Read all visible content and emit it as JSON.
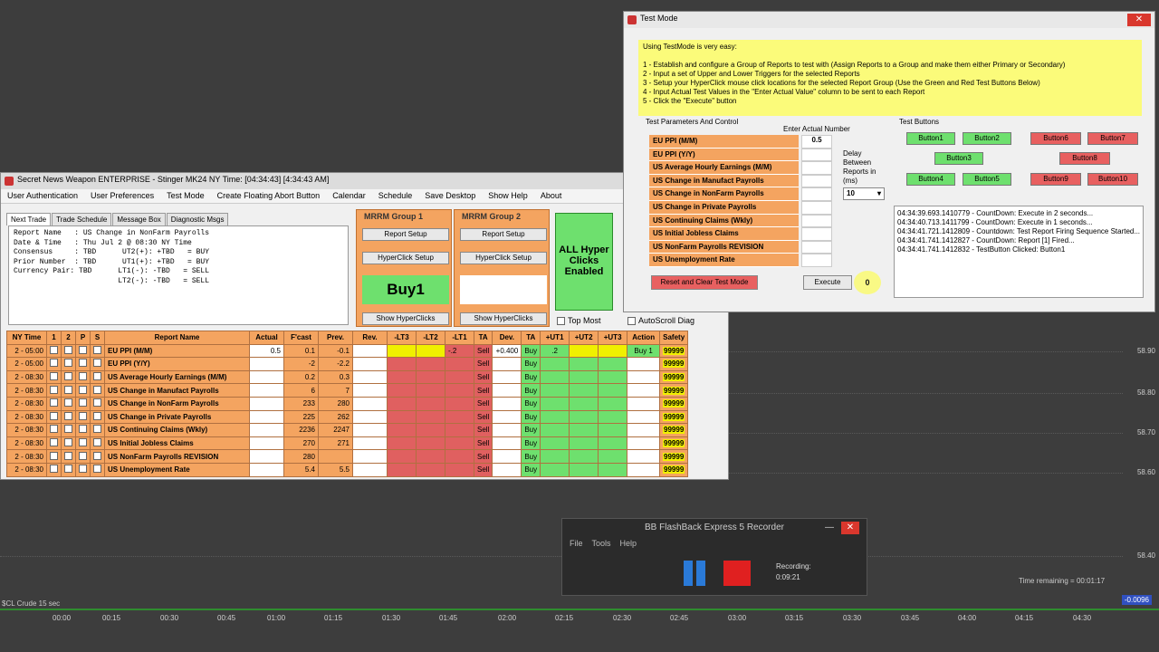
{
  "background_chart": {
    "prices": [
      "58.90",
      "58.80",
      "58.70",
      "58.60",
      "58.40"
    ],
    "times": [
      "00:00",
      "00:15",
      "00:30",
      "00:45",
      "01:00",
      "01:15",
      "01:30",
      "01:45",
      "02:00",
      "02:15",
      "02:30",
      "02:45",
      "03:00",
      "03:15",
      "03:30",
      "03:45",
      "04:00",
      "04:15",
      "04:30"
    ],
    "time_remaining": "Time remaining = 00:01:17",
    "last_badge": "-0.0096",
    "left_label": "$CL Crude  15 sec"
  },
  "main": {
    "title": "Secret News Weapon ENTERPRISE - Stinger MK24     NY Time: [04:34:43]  [4:34:43 AM]",
    "menu": [
      "User Authentication",
      "User Preferences",
      "Test Mode",
      "Create Floating Abort Button",
      "Calendar",
      "Schedule",
      "Save Desktop",
      "Show Help",
      "About"
    ],
    "tabs": [
      "Next Trade",
      "Trade Schedule",
      "Message Box",
      "Diagnostic Msgs"
    ],
    "info": "Report Name   : US Change in NonFarm Payrolls\nDate & Time   : Thu Jul 2 @ 08:30 NY Time\nConsensus     : TBD      UT2(+): +TBD   = BUY\nPrior Number  : TBD      UT1(+): +TBD   = BUY\nCurrency Pair: TBD      LT1(-): -TBD   = SELL\n                        LT2(-): -TBD   = SELL",
    "group1": {
      "title": "MRRM  Group 1",
      "setup": "Report Setup",
      "hyper": "HyperClick Setup",
      "big": "Buy1",
      "show": "Show HyperClicks"
    },
    "group2": {
      "title": "MRRM  Group 2",
      "setup": "Report Setup",
      "hyper": "HyperClick Setup",
      "big": "",
      "show": "Show HyperClicks"
    },
    "all_hyper": "ALL Hyper Clicks Enabled",
    "top_most": "Top Most",
    "autoscroll": "AutoScroll Diag",
    "headers": [
      "NY Time",
      "1",
      "2",
      "P",
      "S",
      "Report Name",
      "Actual",
      "F'cast",
      "Prev.",
      "Rev.",
      "-LT3",
      "-LT2",
      "-LT1",
      "TA",
      "Dev.",
      "TA",
      "+UT1",
      "+UT2",
      "+UT3",
      "Action",
      "Safety"
    ],
    "rows": [
      {
        "time": "2 - 05:00",
        "name": "EU PPI (M/M)",
        "actual": "0.5",
        "fcast": "0.1",
        "prev": "-0.1",
        "lt1": "-.2",
        "ta": "Sell",
        "dev": "+0.400",
        "ta2": "Buy",
        "ut1": ".2",
        "action": "Buy 1",
        "safety": "99999"
      },
      {
        "time": "2 - 05:00",
        "name": "EU PPI (Y/Y)",
        "actual": "",
        "fcast": "-2",
        "prev": "-2.2",
        "lt1": "",
        "ta": "Sell",
        "dev": "",
        "ta2": "Buy",
        "ut1": "",
        "action": "",
        "safety": "99999"
      },
      {
        "time": "2 - 08:30",
        "name": "US Average Hourly Earnings (M/M)",
        "actual": "",
        "fcast": "0.2",
        "prev": "0.3",
        "lt1": "",
        "ta": "Sell",
        "dev": "",
        "ta2": "Buy",
        "ut1": "",
        "action": "",
        "safety": "99999"
      },
      {
        "time": "2 - 08:30",
        "name": "US Change in Manufact Payrolls",
        "actual": "",
        "fcast": "6",
        "prev": "7",
        "lt1": "",
        "ta": "Sell",
        "dev": "",
        "ta2": "Buy",
        "ut1": "",
        "action": "",
        "safety": "99999"
      },
      {
        "time": "2 - 08:30",
        "name": "US Change in NonFarm Payrolls",
        "actual": "",
        "fcast": "233",
        "prev": "280",
        "lt1": "",
        "ta": "Sell",
        "dev": "",
        "ta2": "Buy",
        "ut1": "",
        "action": "",
        "safety": "99999"
      },
      {
        "time": "2 - 08:30",
        "name": "US Change in Private Payrolls",
        "actual": "",
        "fcast": "225",
        "prev": "262",
        "lt1": "",
        "ta": "Sell",
        "dev": "",
        "ta2": "Buy",
        "ut1": "",
        "action": "",
        "safety": "99999"
      },
      {
        "time": "2 - 08:30",
        "name": "US Continuing Claims (Wkly)",
        "actual": "",
        "fcast": "2236",
        "prev": "2247",
        "lt1": "",
        "ta": "Sell",
        "dev": "",
        "ta2": "Buy",
        "ut1": "",
        "action": "",
        "safety": "99999"
      },
      {
        "time": "2 - 08:30",
        "name": "US Initial Jobless Claims",
        "actual": "",
        "fcast": "270",
        "prev": "271",
        "lt1": "",
        "ta": "Sell",
        "dev": "",
        "ta2": "Buy",
        "ut1": "",
        "action": "",
        "safety": "99999"
      },
      {
        "time": "2 - 08:30",
        "name": "US NonFarm Payrolls REVISION",
        "actual": "",
        "fcast": "280",
        "prev": "",
        "lt1": "",
        "ta": "Sell",
        "dev": "",
        "ta2": "Buy",
        "ut1": "",
        "action": "",
        "safety": "99999"
      },
      {
        "time": "2 - 08:30",
        "name": "US Unemployment Rate",
        "actual": "",
        "fcast": "5.4",
        "prev": "5.5",
        "lt1": "",
        "ta": "Sell",
        "dev": "",
        "ta2": "Buy",
        "ut1": "",
        "action": "",
        "safety": "99999"
      }
    ]
  },
  "test": {
    "title": "Test Mode",
    "close": "✕",
    "instr_head": "Using TestMode is very easy:",
    "instr": [
      "1 - Establish and configure a Group of Reports to test with (Assign Reports to a Group and make them either Primary or Secondary)",
      "2 - Input a set of Upper and Lower Triggers for the selected Reports",
      "3 - Setup your HyperClick mouse click locations for the selected Report Group (Use the Green and Red Test Buttons Below)",
      "4 - Input Actual Test Values in the \"Enter Actual Value\" column to be sent to each Report",
      "5 - Click the \"Execute\" button"
    ],
    "params_label": "Test Parameters And Control",
    "enter_label": "Enter Actual Number",
    "reports": [
      "EU PPI (M/M)",
      "EU PPI (Y/Y)",
      "US Average Hourly Earnings (M/M)",
      "US Change in Manufact Payrolls",
      "US Change in NonFarm Payrolls",
      "US Change in Private Payrolls",
      "US Continuing Claims (Wkly)",
      "US Initial Jobless Claims",
      "US NonFarm Payrolls REVISION",
      "US Unemployment Rate"
    ],
    "values": [
      "0.5",
      "",
      "",
      "",
      "",
      "",
      "",
      "",
      "",
      ""
    ],
    "delay_label": "Delay Between Reports in (ms)",
    "delay_value": "10",
    "reset": "Reset and Clear Test Mode",
    "execute": "Execute",
    "exec_count": "0",
    "buttons_label": "Test Buttons",
    "buttons": [
      "Button1",
      "Button2",
      "Button3",
      "Button4",
      "Button5",
      "Button6",
      "Button7",
      "Button8",
      "Button9",
      "Button10"
    ],
    "log": [
      "04:34:39.693.1410779 - CountDown: Execute in 2 seconds...",
      "04:34:40.713.1411799 - CountDown: Execute in 1 seconds...",
      "04:34:41.721.1412809 - Countdown: Test Report Firing Sequence Started...",
      "04:34:41.741.1412827 - CountDown: Report [1] Fired...",
      "04:34:41.741.1412832 - TestButton Clicked: Button1"
    ]
  },
  "recorder": {
    "title": "BB FlashBack Express 5 Recorder",
    "menu": [
      "File",
      "Tools",
      "Help"
    ],
    "recording_label": "Recording:",
    "recording_time": "0:09:21"
  }
}
